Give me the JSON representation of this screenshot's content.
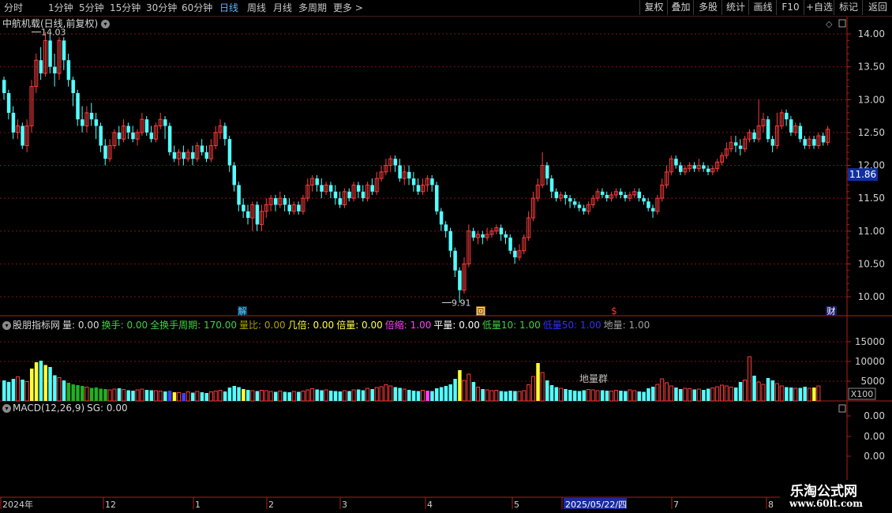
{
  "topbar": {
    "tabs": [
      "分时",
      "1分钟",
      "5分钟",
      "15分钟",
      "30分钟",
      "60分钟",
      "日线",
      "周线",
      "月线",
      "多周期",
      "更多 >"
    ],
    "active_tab": "日线",
    "right_buttons": [
      "复权",
      "叠加",
      "多股",
      "统计",
      "画线",
      "F10",
      "+自选",
      "标记",
      "返回"
    ]
  },
  "main": {
    "title": "中航机载(日线,前复权)",
    "current_price_label": "11.86",
    "high_label": "14.03",
    "low_label": "9.91",
    "price_ticks": [
      "14.00",
      "13.50",
      "13.00",
      "12.50",
      "12.00",
      "11.50",
      "11.00",
      "10.50",
      "10.00"
    ],
    "markers": {
      "jie": "解",
      "hui": "回",
      "dollar": "$",
      "cai": "财"
    }
  },
  "volume_panel": {
    "name": "股朋指标网",
    "items": [
      {
        "label": "量: 0.00",
        "color": "#d8d8d8"
      },
      {
        "label": "换手: 0.00",
        "color": "#3fd23f"
      },
      {
        "label": "全换手周期: 170.00",
        "color": "#3fd23f"
      },
      {
        "label": "量比: 0.00",
        "color": "#b0a000"
      },
      {
        "label": "几倍: 0.00",
        "color": "#ffff40"
      },
      {
        "label": "倍量: 0.00",
        "color": "#ffff40"
      },
      {
        "label": "倍缩: 1.00",
        "color": "#ff40ff"
      },
      {
        "label": "平量: 0.00",
        "color": "#ffffff"
      },
      {
        "label": "低量10: 1.00",
        "color": "#3fd23f"
      },
      {
        "label": "低量50: 1.00",
        "color": "#3030ff"
      },
      {
        "label": "地量: 1.00",
        "color": "#a0a0a0"
      }
    ],
    "ticks": [
      "15000",
      "10000",
      "5000"
    ],
    "unit": "X100",
    "annotation": "地量群"
  },
  "macd_panel": {
    "title": "MACD(12,26,9)",
    "sg": "SG: 0.00",
    "ticks": [
      "0.00",
      "0.00",
      "0.00"
    ]
  },
  "date_axis": {
    "labels": [
      "2024年",
      "12",
      "1",
      "2",
      "3",
      "4",
      "5",
      "2025/05/22/四",
      "7",
      "8"
    ]
  },
  "logo": {
    "cn": "乐淘公式网",
    "url": "www.60lt.com"
  },
  "colors": {
    "up": "#ff3c3c",
    "down": "#54ffff",
    "grid": "#7a1414",
    "axis": "#b01e1e",
    "highlight_bar": "#ffff30",
    "magenta_bar": "#ff40ff",
    "blue_bar": "#4040ff",
    "green_bar": "#22b022"
  },
  "chart_data": {
    "type": "candlestick",
    "price_range": [
      9.8,
      14.2
    ],
    "candles": [
      [
        13.3,
        13.1,
        13.35,
        13.0
      ],
      [
        13.1,
        12.8,
        13.15,
        12.7
      ],
      [
        12.8,
        12.5,
        12.9,
        12.4
      ],
      [
        12.5,
        12.6,
        12.7,
        12.4
      ],
      [
        12.6,
        12.3,
        12.65,
        12.25
      ],
      [
        12.3,
        12.6,
        12.7,
        12.2
      ],
      [
        12.6,
        13.2,
        13.3,
        12.5
      ],
      [
        13.2,
        13.6,
        13.7,
        13.1
      ],
      [
        13.6,
        13.4,
        13.8,
        13.3
      ],
      [
        13.4,
        13.9,
        14.03,
        13.35
      ],
      [
        13.9,
        13.5,
        14.0,
        13.4
      ],
      [
        13.5,
        13.4,
        13.7,
        13.2
      ],
      [
        13.4,
        13.9,
        13.95,
        13.3
      ],
      [
        13.9,
        13.6,
        13.95,
        13.45
      ],
      [
        13.6,
        13.3,
        13.7,
        13.2
      ],
      [
        13.3,
        13.1,
        13.35,
        12.9
      ],
      [
        13.1,
        12.7,
        13.15,
        12.6
      ],
      [
        12.7,
        12.6,
        12.9,
        12.5
      ],
      [
        12.6,
        12.8,
        12.9,
        12.5
      ],
      [
        12.8,
        12.7,
        12.95,
        12.6
      ],
      [
        12.7,
        12.6,
        12.8,
        12.4
      ],
      [
        12.6,
        12.3,
        12.65,
        12.2
      ],
      [
        12.3,
        12.1,
        12.4,
        12.0
      ],
      [
        12.1,
        12.3,
        12.4,
        12.05
      ],
      [
        12.3,
        12.5,
        12.55,
        12.25
      ],
      [
        12.5,
        12.4,
        12.6,
        12.3
      ],
      [
        12.4,
        12.6,
        12.7,
        12.35
      ],
      [
        12.6,
        12.5,
        12.65,
        12.4
      ],
      [
        12.5,
        12.4,
        12.6,
        12.35
      ],
      [
        12.4,
        12.5,
        12.55,
        12.3
      ],
      [
        12.5,
        12.7,
        12.8,
        12.45
      ],
      [
        12.7,
        12.5,
        12.75,
        12.45
      ],
      [
        12.5,
        12.4,
        12.6,
        12.35
      ],
      [
        12.4,
        12.6,
        12.65,
        12.35
      ],
      [
        12.6,
        12.7,
        12.8,
        12.55
      ],
      [
        12.7,
        12.6,
        12.75,
        12.4
      ],
      [
        12.6,
        12.2,
        12.65,
        12.15
      ],
      [
        12.2,
        12.1,
        12.3,
        12.05
      ],
      [
        12.1,
        12.2,
        12.25,
        12.0
      ],
      [
        12.2,
        12.1,
        12.3,
        12.0
      ],
      [
        12.1,
        12.2,
        12.25,
        12.05
      ],
      [
        12.2,
        12.1,
        12.3,
        12.0
      ],
      [
        12.1,
        12.3,
        12.35,
        12.05
      ],
      [
        12.3,
        12.2,
        12.4,
        12.15
      ],
      [
        12.2,
        12.1,
        12.3,
        12.05
      ],
      [
        12.1,
        12.3,
        12.4,
        12.05
      ],
      [
        12.3,
        12.5,
        12.6,
        12.25
      ],
      [
        12.5,
        12.6,
        12.7,
        12.4
      ],
      [
        12.6,
        12.4,
        12.65,
        12.3
      ],
      [
        12.4,
        12.0,
        12.45,
        11.9
      ],
      [
        12.0,
        11.7,
        12.05,
        11.6
      ],
      [
        11.7,
        11.4,
        11.75,
        11.3
      ],
      [
        11.4,
        11.3,
        11.5,
        11.2
      ],
      [
        11.3,
        11.2,
        11.4,
        11.1
      ],
      [
        11.2,
        11.4,
        11.45,
        11.0
      ],
      [
        11.4,
        11.1,
        11.45,
        11.0
      ],
      [
        11.1,
        11.3,
        11.4,
        11.0
      ],
      [
        11.3,
        11.4,
        11.5,
        11.2
      ],
      [
        11.4,
        11.5,
        11.55,
        11.3
      ],
      [
        11.5,
        11.4,
        11.55,
        11.3
      ],
      [
        11.4,
        11.5,
        11.6,
        11.35
      ],
      [
        11.5,
        11.4,
        11.55,
        11.3
      ],
      [
        11.4,
        11.3,
        11.5,
        11.25
      ],
      [
        11.3,
        11.4,
        11.45,
        11.25
      ],
      [
        11.4,
        11.3,
        11.45,
        11.25
      ],
      [
        11.3,
        11.5,
        11.55,
        11.25
      ],
      [
        11.5,
        11.7,
        11.8,
        11.45
      ],
      [
        11.7,
        11.8,
        11.85,
        11.6
      ],
      [
        11.8,
        11.7,
        11.85,
        11.6
      ],
      [
        11.7,
        11.6,
        11.8,
        11.5
      ],
      [
        11.6,
        11.7,
        11.75,
        11.55
      ],
      [
        11.7,
        11.6,
        11.75,
        11.5
      ],
      [
        11.6,
        11.5,
        11.7,
        11.4
      ],
      [
        11.5,
        11.4,
        11.6,
        11.35
      ],
      [
        11.4,
        11.6,
        11.65,
        11.35
      ],
      [
        11.6,
        11.5,
        11.65,
        11.45
      ],
      [
        11.5,
        11.7,
        11.75,
        11.45
      ],
      [
        11.7,
        11.6,
        11.75,
        11.5
      ],
      [
        11.6,
        11.5,
        11.7,
        11.45
      ],
      [
        11.5,
        11.7,
        11.75,
        11.45
      ],
      [
        11.7,
        11.6,
        11.8,
        11.55
      ],
      [
        11.6,
        11.8,
        11.9,
        11.55
      ],
      [
        11.8,
        11.9,
        12.0,
        11.75
      ],
      [
        11.9,
        12.0,
        12.1,
        11.85
      ],
      [
        12.0,
        12.1,
        12.15,
        11.9
      ],
      [
        12.1,
        12.0,
        12.15,
        11.9
      ],
      [
        12.0,
        11.8,
        12.1,
        11.75
      ],
      [
        11.8,
        11.9,
        12.0,
        11.7
      ],
      [
        11.9,
        11.8,
        12.0,
        11.7
      ],
      [
        11.8,
        11.7,
        11.9,
        11.6
      ],
      [
        11.7,
        11.6,
        11.8,
        11.55
      ],
      [
        11.6,
        11.7,
        11.8,
        11.55
      ],
      [
        11.7,
        11.8,
        11.85,
        11.6
      ],
      [
        11.8,
        11.7,
        11.85,
        11.6
      ],
      [
        11.7,
        11.3,
        11.75,
        11.25
      ],
      [
        11.3,
        11.1,
        11.35,
        11.0
      ],
      [
        11.1,
        11.0,
        11.15,
        10.9
      ],
      [
        11.0,
        10.7,
        11.05,
        10.6
      ],
      [
        10.7,
        10.4,
        10.75,
        10.3
      ],
      [
        10.4,
        10.1,
        10.45,
        9.91
      ],
      [
        10.1,
        10.5,
        10.6,
        10.05
      ],
      [
        10.5,
        11.0,
        11.1,
        10.45
      ],
      [
        11.0,
        10.9,
        11.05,
        10.85
      ],
      [
        10.9,
        10.95,
        11.0,
        10.8
      ],
      [
        10.95,
        10.9,
        11.0,
        10.8
      ],
      [
        10.9,
        10.95,
        11.05,
        10.85
      ],
      [
        10.95,
        11.0,
        11.05,
        10.9
      ],
      [
        11.0,
        11.05,
        11.1,
        10.95
      ],
      [
        11.05,
        10.95,
        11.1,
        10.85
      ],
      [
        10.95,
        10.9,
        11.0,
        10.8
      ],
      [
        10.9,
        10.7,
        10.95,
        10.65
      ],
      [
        10.7,
        10.6,
        10.75,
        10.5
      ],
      [
        10.6,
        10.7,
        10.8,
        10.55
      ],
      [
        10.7,
        10.9,
        10.95,
        10.65
      ],
      [
        10.9,
        11.2,
        11.3,
        10.85
      ],
      [
        11.2,
        11.5,
        11.6,
        11.15
      ],
      [
        11.5,
        11.7,
        11.8,
        11.45
      ],
      [
        11.7,
        12.0,
        12.2,
        11.65
      ],
      [
        12.0,
        11.8,
        12.05,
        11.7
      ],
      [
        11.8,
        11.6,
        11.85,
        11.5
      ],
      [
        11.6,
        11.5,
        11.65,
        11.45
      ],
      [
        11.5,
        11.55,
        11.6,
        11.45
      ],
      [
        11.55,
        11.5,
        11.6,
        11.4
      ],
      [
        11.5,
        11.45,
        11.55,
        11.35
      ],
      [
        11.45,
        11.4,
        11.5,
        11.35
      ],
      [
        11.4,
        11.35,
        11.45,
        11.3
      ],
      [
        11.35,
        11.3,
        11.4,
        11.25
      ],
      [
        11.3,
        11.4,
        11.45,
        11.25
      ],
      [
        11.4,
        11.5,
        11.55,
        11.35
      ],
      [
        11.5,
        11.6,
        11.65,
        11.45
      ],
      [
        11.6,
        11.55,
        11.65,
        11.5
      ],
      [
        11.55,
        11.5,
        11.6,
        11.45
      ],
      [
        11.5,
        11.55,
        11.6,
        11.45
      ],
      [
        11.55,
        11.6,
        11.65,
        11.5
      ],
      [
        11.6,
        11.55,
        11.65,
        11.5
      ],
      [
        11.55,
        11.5,
        11.6,
        11.45
      ],
      [
        11.5,
        11.55,
        11.6,
        11.45
      ],
      [
        11.55,
        11.6,
        11.65,
        11.5
      ],
      [
        11.6,
        11.5,
        11.65,
        11.45
      ],
      [
        11.5,
        11.45,
        11.55,
        11.4
      ],
      [
        11.45,
        11.35,
        11.5,
        11.3
      ],
      [
        11.35,
        11.3,
        11.4,
        11.2
      ],
      [
        11.3,
        11.5,
        11.55,
        11.25
      ],
      [
        11.5,
        11.7,
        11.8,
        11.45
      ],
      [
        11.7,
        11.9,
        12.0,
        11.65
      ],
      [
        11.9,
        12.1,
        12.15,
        11.85
      ],
      [
        12.1,
        12.0,
        12.15,
        11.95
      ],
      [
        12.0,
        11.9,
        12.05,
        11.85
      ],
      [
        11.9,
        11.95,
        12.0,
        11.85
      ],
      [
        11.95,
        12.0,
        12.05,
        11.9
      ],
      [
        12.0,
        11.95,
        12.05,
        11.9
      ],
      [
        11.95,
        12.0,
        12.1,
        11.9
      ],
      [
        12.0,
        11.95,
        12.05,
        11.9
      ],
      [
        11.95,
        11.9,
        12.0,
        11.85
      ],
      [
        11.9,
        11.95,
        12.0,
        11.85
      ],
      [
        11.95,
        12.05,
        12.1,
        11.9
      ],
      [
        12.05,
        12.15,
        12.2,
        12.0
      ],
      [
        12.15,
        12.25,
        12.35,
        12.1
      ],
      [
        12.25,
        12.35,
        12.45,
        12.2
      ],
      [
        12.35,
        12.3,
        12.45,
        12.2
      ],
      [
        12.3,
        12.25,
        12.4,
        12.15
      ],
      [
        12.25,
        12.4,
        12.45,
        12.2
      ],
      [
        12.4,
        12.5,
        12.55,
        12.35
      ],
      [
        12.5,
        12.4,
        12.55,
        12.35
      ],
      [
        12.4,
        12.6,
        13.0,
        12.35
      ],
      [
        12.6,
        12.7,
        12.8,
        12.5
      ],
      [
        12.7,
        12.4,
        12.75,
        12.35
      ],
      [
        12.4,
        12.3,
        12.45,
        12.2
      ],
      [
        12.3,
        12.6,
        12.8,
        12.25
      ],
      [
        12.6,
        12.8,
        12.85,
        12.55
      ],
      [
        12.8,
        12.7,
        12.85,
        12.6
      ],
      [
        12.7,
        12.5,
        12.75,
        12.45
      ],
      [
        12.5,
        12.6,
        12.65,
        12.45
      ],
      [
        12.6,
        12.4,
        12.65,
        12.35
      ],
      [
        12.4,
        12.3,
        12.45,
        12.25
      ],
      [
        12.3,
        12.4,
        12.45,
        12.25
      ],
      [
        12.4,
        12.3,
        12.45,
        12.25
      ],
      [
        12.3,
        12.45,
        12.5,
        12.25
      ],
      [
        12.45,
        12.35,
        12.5,
        12.3
      ],
      [
        12.35,
        12.55,
        12.6,
        12.3
      ]
    ],
    "volumes": [
      5200,
      4800,
      5600,
      6100,
      5400,
      4900,
      8200,
      9800,
      10200,
      9100,
      8600,
      6500,
      5900,
      5200,
      4600,
      4200,
      4000,
      3800,
      3500,
      3300,
      3400,
      3100,
      3000,
      2800,
      3000,
      3200,
      2900,
      2700,
      2600,
      2800,
      3000,
      2800,
      2700,
      2600,
      2500,
      2400,
      2600,
      2200,
      2100,
      2000,
      2300,
      2100,
      2400,
      2200,
      2000,
      2300,
      2500,
      2700,
      2400,
      3400,
      3800,
      3500,
      3000,
      2800,
      2600,
      2500,
      2700,
      2600,
      2400,
      2300,
      2500,
      2300,
      2200,
      2400,
      2300,
      2500,
      2800,
      3100,
      2900,
      2700,
      2800,
      2600,
      2500,
      2400,
      2600,
      2500,
      2800,
      2900,
      2700,
      3200,
      3000,
      3400,
      3600,
      4100,
      3800,
      3500,
      3300,
      3000,
      2800,
      2600,
      2500,
      2700,
      2600,
      2500,
      3200,
      3500,
      3800,
      4200,
      5600,
      7800,
      5200,
      6800,
      4800,
      3500,
      3000,
      2800,
      2600,
      2700,
      2500,
      2400,
      2600,
      2500,
      2400,
      2600,
      4100,
      6200,
      9600,
      7200,
      5200,
      4000,
      3500,
      3200,
      3000,
      2800,
      2600,
      2500,
      2700,
      2900,
      2800,
      2600,
      2700,
      2600,
      2500,
      2700,
      2600,
      2500,
      2800,
      2600,
      2400,
      2300,
      3200,
      3600,
      4200,
      5600,
      4600,
      3800,
      3400,
      3000,
      3200,
      3100,
      2900,
      3000,
      2800,
      3100,
      3300,
      3600,
      4000,
      3800,
      3500,
      3400,
      4800,
      5300,
      11200,
      6400,
      4800,
      4200,
      5800,
      5200,
      4400,
      3800,
      3500,
      3400,
      3200,
      3300,
      3600,
      3200,
      3400,
      3800
    ],
    "volume_range": [
      0,
      15000
    ]
  }
}
